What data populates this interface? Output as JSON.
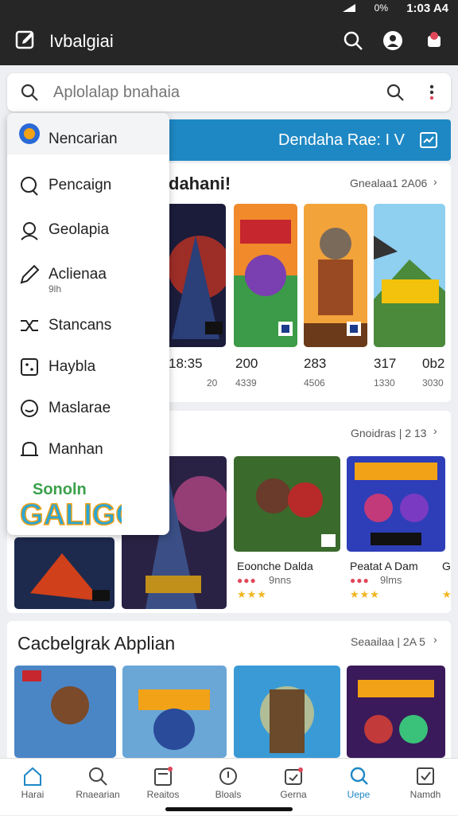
{
  "status_bar": {
    "time": "1:03 A4",
    "battery": "0%"
  },
  "app_bar": {
    "title": "Ivbalgiai"
  },
  "search": {
    "placeholder": "Aplolalap bnahaia"
  },
  "banner": {
    "text": "Dendaha Rae: I V"
  },
  "section1": {
    "title": "dahani!",
    "link": "Gnealaa1 2A06",
    "numbers": [
      "18:35",
      "200",
      "283",
      "317",
      "0b2"
    ],
    "subs": [
      "20",
      "4339",
      "4506",
      "1330",
      "3030"
    ]
  },
  "section2": {
    "link": "Gnoidras | 2 13",
    "items": [
      {
        "name": "Eoonche Dalda",
        "meta": "9nns",
        "stars": "★★★"
      },
      {
        "name": "Peatat A Dam",
        "meta": "9lms",
        "stars": "★★★"
      },
      {
        "name": "G",
        "meta": "",
        "stars": "★"
      }
    ]
  },
  "section3": {
    "title": "Cacbelgrak Abplian",
    "link": "Seaailaa | 2A 5"
  },
  "drawer": {
    "items": [
      {
        "label": "Nencarian",
        "sub": ""
      },
      {
        "label": "Pencaign",
        "sub": ""
      },
      {
        "label": "Geolapia",
        "sub": ""
      },
      {
        "label": "Aclienaa",
        "sub": "9lh"
      },
      {
        "label": "Stancans",
        "sub": ""
      },
      {
        "label": "Haybla",
        "sub": ""
      },
      {
        "label": "Maslarae",
        "sub": ""
      },
      {
        "label": "Manhan",
        "sub": ""
      }
    ],
    "logo_text": "Sonoln GALIGC"
  },
  "bottom_nav": [
    {
      "label": "Harai"
    },
    {
      "label": "Rnaearian"
    },
    {
      "label": "Reaitos"
    },
    {
      "label": "Bloals"
    },
    {
      "label": "Gerna"
    },
    {
      "label": "Uepe"
    },
    {
      "label": "Namdh"
    }
  ],
  "colors": {
    "accent": "#1e88c4",
    "appbar": "#262626",
    "star": "#f2b51e",
    "badge": "#e0485a"
  }
}
